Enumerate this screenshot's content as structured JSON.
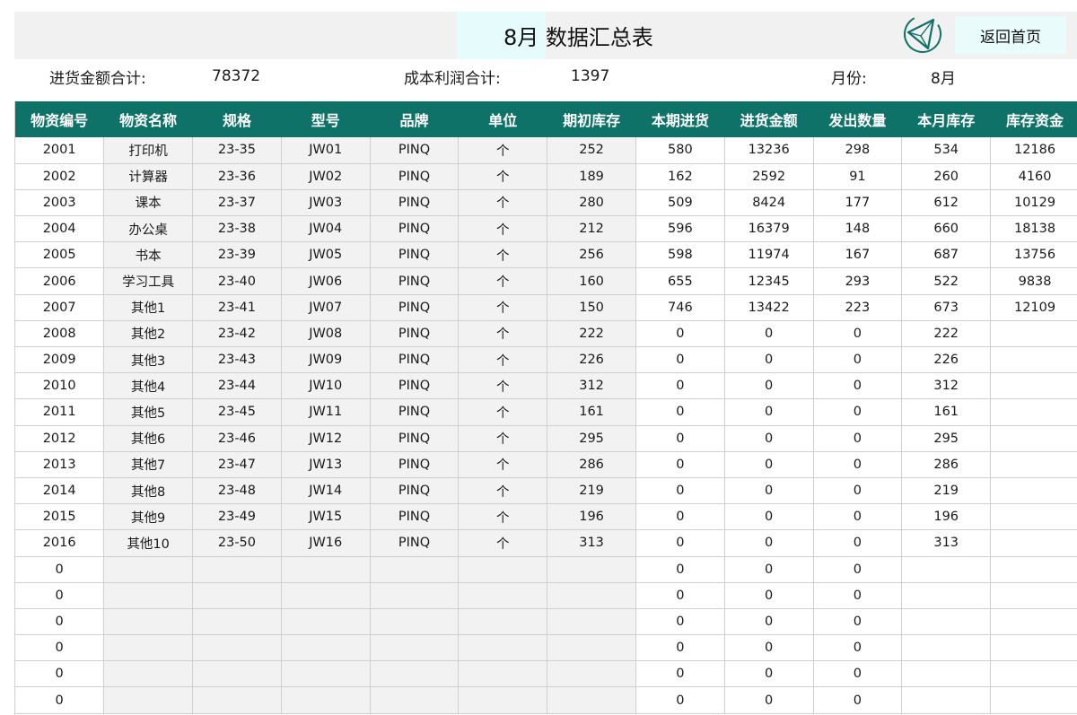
{
  "header": {
    "title": "8月 数据汇总表",
    "home_label": "返回首页",
    "logo_icon": "triangle-logo-icon"
  },
  "summary": {
    "purchase_total_label": "进货金额合计:",
    "purchase_total_value": "78372",
    "profit_total_label": "成本利润合计:",
    "profit_total_value": "1397",
    "month_label": "月份:",
    "month_value": "8月"
  },
  "table": {
    "headers": [
      "物资编号",
      "物资名称",
      "规格",
      "型号",
      "品牌",
      "单位",
      "期初库存",
      "本期进货",
      "进货金额",
      "发出数量",
      "本月库存",
      "库存资金"
    ],
    "rows": [
      [
        "2001",
        "打印机",
        "23-35",
        "JW01",
        "PINQ",
        "个",
        "252",
        "580",
        "13236",
        "298",
        "534",
        "12186"
      ],
      [
        "2002",
        "计算器",
        "23-36",
        "JW02",
        "PINQ",
        "个",
        "189",
        "162",
        "2592",
        "91",
        "260",
        "4160"
      ],
      [
        "2003",
        "课本",
        "23-37",
        "JW03",
        "PINQ",
        "个",
        "280",
        "509",
        "8424",
        "177",
        "612",
        "10129"
      ],
      [
        "2004",
        "办公桌",
        "23-38",
        "JW04",
        "PINQ",
        "个",
        "212",
        "596",
        "16379",
        "148",
        "660",
        "18138"
      ],
      [
        "2005",
        "书本",
        "23-39",
        "JW05",
        "PINQ",
        "个",
        "256",
        "598",
        "11974",
        "167",
        "687",
        "13756"
      ],
      [
        "2006",
        "学习工具",
        "23-40",
        "JW06",
        "PINQ",
        "个",
        "160",
        "655",
        "12345",
        "293",
        "522",
        "9838"
      ],
      [
        "2007",
        "其他1",
        "23-41",
        "JW07",
        "PINQ",
        "个",
        "150",
        "746",
        "13422",
        "223",
        "673",
        "12109"
      ],
      [
        "2008",
        "其他2",
        "23-42",
        "JW08",
        "PINQ",
        "个",
        "222",
        "0",
        "0",
        "0",
        "222",
        ""
      ],
      [
        "2009",
        "其他3",
        "23-43",
        "JW09",
        "PINQ",
        "个",
        "226",
        "0",
        "0",
        "0",
        "226",
        ""
      ],
      [
        "2010",
        "其他4",
        "23-44",
        "JW10",
        "PINQ",
        "个",
        "312",
        "0",
        "0",
        "0",
        "312",
        ""
      ],
      [
        "2011",
        "其他5",
        "23-45",
        "JW11",
        "PINQ",
        "个",
        "161",
        "0",
        "0",
        "0",
        "161",
        ""
      ],
      [
        "2012",
        "其他6",
        "23-46",
        "JW12",
        "PINQ",
        "个",
        "295",
        "0",
        "0",
        "0",
        "295",
        ""
      ],
      [
        "2013",
        "其他7",
        "23-47",
        "JW13",
        "PINQ",
        "个",
        "286",
        "0",
        "0",
        "0",
        "286",
        ""
      ],
      [
        "2014",
        "其他8",
        "23-48",
        "JW14",
        "PINQ",
        "个",
        "219",
        "0",
        "0",
        "0",
        "219",
        ""
      ],
      [
        "2015",
        "其他9",
        "23-49",
        "JW15",
        "PINQ",
        "个",
        "196",
        "0",
        "0",
        "0",
        "196",
        ""
      ],
      [
        "2016",
        "其他10",
        "23-50",
        "JW16",
        "PINQ",
        "个",
        "313",
        "0",
        "0",
        "0",
        "313",
        ""
      ],
      [
        "0",
        "",
        "",
        "",
        "",
        "",
        "",
        "0",
        "0",
        "0",
        "",
        ""
      ],
      [
        "0",
        "",
        "",
        "",
        "",
        "",
        "",
        "0",
        "0",
        "0",
        "",
        ""
      ],
      [
        "0",
        "",
        "",
        "",
        "",
        "",
        "",
        "0",
        "0",
        "0",
        "",
        ""
      ],
      [
        "0",
        "",
        "",
        "",
        "",
        "",
        "",
        "0",
        "0",
        "0",
        "",
        ""
      ],
      [
        "0",
        "",
        "",
        "",
        "",
        "",
        "",
        "0",
        "0",
        "0",
        "",
        ""
      ],
      [
        "0",
        "",
        "",
        "",
        "",
        "",
        "",
        "0",
        "0",
        "0",
        "",
        ""
      ]
    ]
  },
  "colors": {
    "header_bg": "#0e7268",
    "title_bar_bg": "#f1f1f1",
    "accent_cyan": "#e6fbfb",
    "shaded_cell_bg": "#f2f2f2"
  }
}
